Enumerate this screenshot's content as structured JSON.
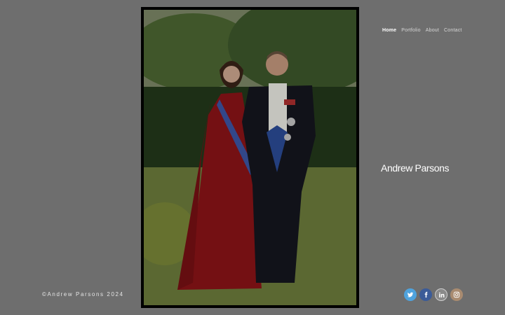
{
  "nav": {
    "items": [
      {
        "label": "Home",
        "active": true
      },
      {
        "label": "Portfolio",
        "active": false
      },
      {
        "label": "About",
        "active": false
      },
      {
        "label": "Contact",
        "active": false
      }
    ]
  },
  "site": {
    "title": "Andrew Parsons",
    "copyright": "©Andrew Parsons 2024"
  },
  "social": {
    "icons": [
      "twitter-icon",
      "facebook-icon",
      "linkedin-icon",
      "instagram-icon"
    ]
  },
  "colors": {
    "background": "#6e6e6e",
    "frame": "#000000",
    "twitter": "#4fa3dd",
    "facebook": "#3b5b98",
    "instagram": "#a98b70"
  }
}
